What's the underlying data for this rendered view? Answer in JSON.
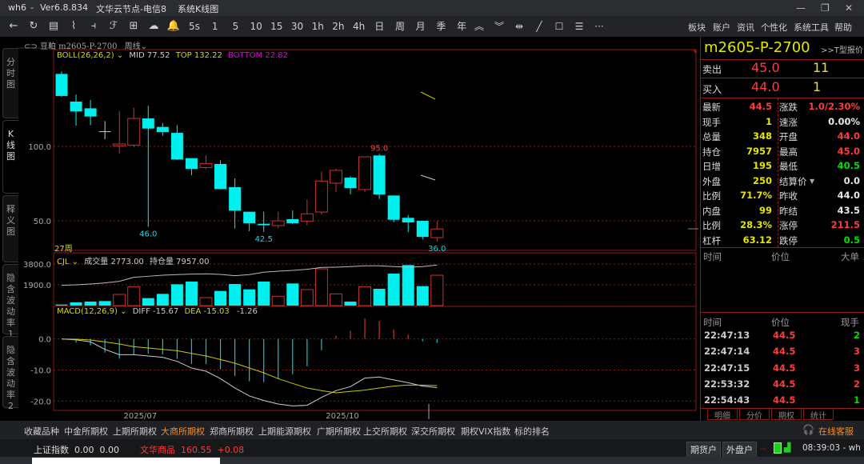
{
  "window": {
    "app": "wh6",
    "sep": "-",
    "version": "Ver6.8.834",
    "server": "文华云节点-电信8",
    "view": "系统K线图",
    "min": "—",
    "max": "❐",
    "close": "✕"
  },
  "toolbar": {
    "icons": [
      "back-icon",
      "refresh-icon",
      "table-icon",
      "line-chart-icon",
      "candle-icon",
      "formula-icon",
      "grid-icon",
      "cloud-icon",
      "bell-icon"
    ],
    "icon_glyphs": [
      "←",
      "↻",
      "▤",
      "⌇",
      "⫞",
      "ℱ",
      "⊞",
      "☁",
      "🔔"
    ],
    "periods": [
      "5s",
      "1",
      "5",
      "10",
      "15",
      "30",
      "1h",
      "2h",
      "4h",
      "日",
      "周",
      "月",
      "季",
      "年"
    ],
    "tools_glyphs": [
      "︽",
      "︾",
      "⇹",
      "╱",
      "☐",
      "☰",
      "···"
    ],
    "tools": [
      "scroll-up-icon",
      "scroll-down-icon",
      "resize-icon",
      "draw-line-icon",
      "rectangle-icon",
      "list-icon",
      "more-icon"
    ],
    "menu": [
      "板块",
      "账户",
      "资讯",
      "个性化",
      "系统工具",
      "帮助"
    ]
  },
  "header": {
    "link_icon": "⊂⊃",
    "name": "豆粕",
    "code": "m2605-P-2700",
    "period": "周线"
  },
  "side_tabs": [
    "分时图",
    "K线图",
    "释义图",
    "隐含波动率1",
    "隐含波动率2"
  ],
  "boll": {
    "label": "BOLL(26,26,2)",
    "mid": "MID 77.52",
    "top": "TOP 132.22",
    "bottom": "BOTTOM 22.82"
  },
  "cjl": {
    "label": "CJL",
    "vol": "成交量 2773.00",
    "oi": "持仓量 7957.00"
  },
  "macd": {
    "label": "MACD(12,26,9)",
    "diff": "DIFF -15.67",
    "dea": "DEA -15.03",
    "macd": "-1.26"
  },
  "colors": {
    "up": "#c83232",
    "down": "#00f0f0",
    "diff": "#cccccc",
    "dea": "#c8c800",
    "grid": "#8b1a1a",
    "yellow": "#e6e600",
    "red": "#ff3b3b",
    "green": "#00e000"
  },
  "chart_data": {
    "type": "candlestick",
    "bars_label": "27周",
    "candles": [
      [
        148.7,
        133.9,
        150.5,
        133.2
      ],
      [
        130.1,
        123.5,
        134.9,
        114
      ],
      [
        125.6,
        120.1,
        131.2,
        114.3
      ],
      [
        109.9,
        109.9,
        117,
        104.8
      ],
      [
        100.4,
        101.6,
        123.7,
        95.2
      ],
      [
        100.9,
        118.8,
        126,
        99.6
      ],
      [
        118.8,
        112,
        127.2,
        46
      ],
      [
        113.1,
        109.7,
        115.6,
        107.2
      ],
      [
        109.1,
        91.2,
        114.2,
        91
      ],
      [
        92.1,
        84.9,
        92.1,
        80.6
      ],
      [
        85.8,
        88.5,
        94.1,
        84.6
      ],
      [
        88.2,
        71.3,
        90.7,
        71.3
      ],
      [
        72.6,
        56.8,
        78.5,
        44.8
      ],
      [
        56.1,
        48.4,
        56.1,
        43
      ],
      [
        48,
        47,
        56.1,
        42.5
      ],
      [
        46.8,
        50,
        56.1,
        45
      ],
      [
        51.1,
        48.4,
        57,
        47.7
      ],
      [
        49.8,
        54.7,
        64.2,
        47
      ],
      [
        55.9,
        76.7,
        83,
        54.3
      ],
      [
        75.3,
        83.9,
        85.1,
        69.5
      ],
      [
        79,
        72,
        79.9,
        67.7
      ],
      [
        71,
        93,
        93,
        69.5
      ],
      [
        93.9,
        67.7,
        95,
        64.7
      ],
      [
        67,
        50.7,
        67,
        49
      ],
      [
        52,
        48.9,
        53.8,
        42.3
      ],
      [
        50,
        39.2,
        50,
        37.6
      ],
      [
        38.7,
        44.5,
        49.8,
        36
      ]
    ],
    "price_ticks": [
      "100.0",
      "50.0"
    ],
    "price_tick_values": [
      100,
      50
    ],
    "annotations": [
      {
        "i": 6,
        "text": "46.0",
        "at": "low"
      },
      {
        "i": 14,
        "text": "42.5",
        "at": "low"
      },
      {
        "i": 22,
        "text": "95.0",
        "at": "high"
      },
      {
        "i": 26,
        "text": "36.0",
        "at": "low"
      }
    ],
    "volume": [
      97,
      292,
      365,
      414,
      1023,
      1729,
      682,
      1072,
      1949,
      2192,
      731,
      1340,
      1973,
      1486,
      2192,
      853,
      2022,
      1461,
      3362,
      1072,
      365,
      1729,
      1535,
      2923,
      3703,
      1778,
      2773
    ],
    "open_interest": [
      3979,
      4083,
      4240,
      4450,
      4764,
      5549,
      5758,
      5968,
      6073,
      6177,
      6230,
      6125,
      5863,
      6073,
      6544,
      6753,
      6910,
      7119,
      7486,
      7538,
      7643,
      7800,
      7800,
      7643,
      7538,
      7643,
      7957
    ],
    "vol_ticks": [
      "3800.0",
      "1900.0"
    ],
    "vol_tick_values": [
      3800,
      1900
    ],
    "diff": [
      0,
      -0.26,
      -0.94,
      -3.35,
      -5.06,
      -5.06,
      -5.49,
      -5.92,
      -7.21,
      -9.36,
      -10.39,
      -12.79,
      -15.79,
      -18.37,
      -19.83,
      -20.94,
      -21.55,
      -21.37,
      -18.8,
      -16.65,
      -15.36,
      -12.62,
      -12.27,
      -13.2,
      -14.08,
      -15.19,
      -15.67
    ],
    "dea": [
      0,
      -0.09,
      -0.34,
      -0.94,
      -1.63,
      -2.49,
      -2.92,
      -3.35,
      -3.78,
      -4.64,
      -5.49,
      -6.61,
      -7.81,
      -9.36,
      -10.9,
      -12.79,
      -14.33,
      -15.79,
      -16.65,
      -17.34,
      -16.9,
      -16.48,
      -15.79,
      -15.19,
      -14.85,
      -14.85,
      -15.03
    ],
    "macd_hist": [
      0,
      -1.2,
      -2.06,
      -4.38,
      -6.35,
      -5.15,
      -4.72,
      -4.98,
      -6.44,
      -8.07,
      -8.07,
      -9.79,
      -11.93,
      -13.65,
      -13.91,
      -12.96,
      -11.33,
      -8.76,
      -3.61,
      1.03,
      2.66,
      6.61,
      5.84,
      3.09,
      1.37,
      -0.77,
      -1.26
    ],
    "macd_ticks": [
      "0.0",
      "-10.0",
      "-20.0"
    ],
    "macd_tick_values": [
      0,
      -10,
      -20
    ],
    "x_labels": [
      {
        "i": 6,
        "text": "2025/07"
      },
      {
        "i": 20,
        "text": "2025/10"
      }
    ]
  },
  "quote": {
    "symbol": "m2605-P-2700",
    "t_quote": ">>T型报价",
    "ask": {
      "label": "卖出",
      "price": "45.0",
      "qty": "11"
    },
    "bid": {
      "label": "买入",
      "price": "44.0",
      "qty": "1"
    },
    "stats": [
      {
        "l": "最新",
        "v": "44.5",
        "c": "red",
        "l2": "涨跌",
        "v2": "1.0/2.30%",
        "c2": "red"
      },
      {
        "l": "现手",
        "v": "1",
        "c": "yellow",
        "l2": "速涨",
        "v2": "0.00%",
        "c2": "white"
      },
      {
        "l": "总量",
        "v": "348",
        "c": "yellow",
        "l2": "开盘",
        "v2": "44.0",
        "c2": "red"
      },
      {
        "l": "持仓",
        "v": "7957",
        "c": "yellow",
        "l2": "最高",
        "v2": "45.0",
        "c2": "red"
      },
      {
        "l": "日增",
        "v": "195",
        "c": "yellow",
        "l2": "最低",
        "v2": "40.5",
        "c2": "green"
      },
      {
        "l": "外盘",
        "v": "250",
        "c": "yellow",
        "l2": "结算价",
        "v2": "0.0",
        "c2": "white"
      },
      {
        "l": "比例",
        "v": "71.7%",
        "c": "yellow",
        "l2": "昨收",
        "v2": "44.0",
        "c2": "white"
      },
      {
        "l": "内盘",
        "v": "99",
        "c": "yellow",
        "l2": "昨结",
        "v2": "43.5",
        "c2": "white"
      },
      {
        "l": "比例",
        "v": "28.3%",
        "c": "yellow",
        "l2": "涨停",
        "v2": "211.5",
        "c2": "red"
      },
      {
        "l": "杠杆",
        "v": "63.12",
        "c": "yellow",
        "l2": "跌停",
        "v2": "0.5",
        "c2": "green"
      }
    ],
    "big_header": [
      "时间",
      "价位",
      "大单"
    ],
    "trade_header": [
      "时间",
      "价位",
      "现手"
    ],
    "trades": [
      {
        "t": "22:47:13",
        "p": "44.5",
        "q": "2",
        "c": "green"
      },
      {
        "t": "22:47:14",
        "p": "44.5",
        "q": "3",
        "c": "red"
      },
      {
        "t": "22:47:15",
        "p": "44.5",
        "q": "3",
        "c": "red"
      },
      {
        "t": "22:53:32",
        "p": "44.5",
        "q": "2",
        "c": "red"
      },
      {
        "t": "22:54:43",
        "p": "44.5",
        "q": "1",
        "c": "green"
      }
    ],
    "tabs": [
      "明细",
      "分价",
      "期权",
      "统计"
    ]
  },
  "bottom_tabs": [
    "收藏品种",
    "中金所期权",
    "上期所期权",
    "大商所期权",
    "郑商所期权",
    "上期能源期权",
    "广期所期权",
    "上交所期权",
    "深交所期权",
    "期权VIX指数",
    "标的排名"
  ],
  "active_bottom_tab": "大商所期权",
  "service": "在线客服",
  "status": {
    "index": "上证指数  0.00  0.00",
    "wh": "文华商品  160.55  +0.08",
    "btn1": "期货户",
    "btn2": "外盘户",
    "time": "08:39:03 - wh"
  }
}
